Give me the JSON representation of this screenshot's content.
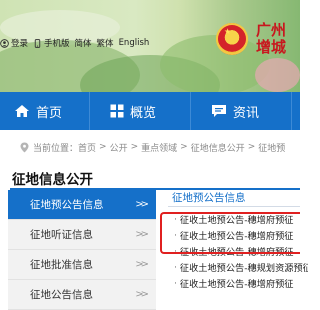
{
  "header": {
    "site_name": "广州市增城区",
    "site_name_visible": "广州\n增城",
    "links": [
      {
        "label": "登录",
        "icon": "user-icon"
      },
      {
        "label": "手机版",
        "icon": "phone-icon"
      },
      {
        "label": "简体"
      },
      {
        "label": "繁体"
      },
      {
        "label": "English"
      }
    ]
  },
  "nav": {
    "items": [
      {
        "label": "首页",
        "icon": "home-icon"
      },
      {
        "label": "概览",
        "icon": "grid-icon"
      },
      {
        "label": "资讯",
        "icon": "message-icon"
      }
    ]
  },
  "breadcrumb": {
    "prefix": "当前位置：",
    "items": [
      "首页",
      "公开",
      "重点领域",
      "征地信息公开",
      "征地预"
    ]
  },
  "section": {
    "title": "征地信息公开"
  },
  "sidebar": {
    "items": [
      {
        "label": "征地预公告信息",
        "active": true
      },
      {
        "label": "征地听证信息",
        "active": false
      },
      {
        "label": "征地批准信息",
        "active": false
      },
      {
        "label": "征地公告信息",
        "active": false
      }
    ]
  },
  "content": {
    "title": "征地预公告信息",
    "items": [
      "征收土地预公告-穗增府预征",
      "征收土地预公告-穗增府预征",
      "征收土地预公告-穗增府预征",
      "征收土地预公告-穗规划资源预征",
      "征收土地预公告-穗增府预征"
    ]
  },
  "colors": {
    "nav_blue": "#1570c9",
    "highlight_red": "#e02020",
    "site_name_red": "#c8171e"
  }
}
